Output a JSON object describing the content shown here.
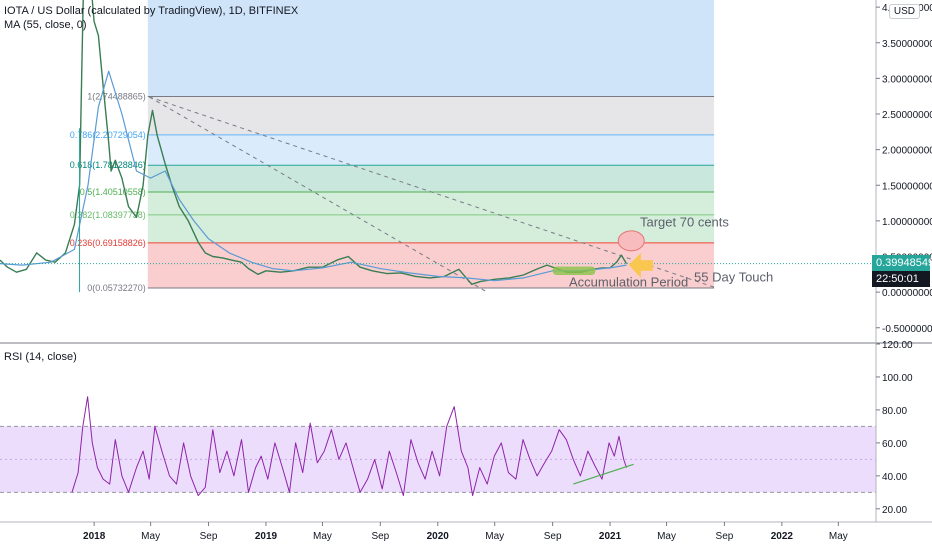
{
  "header": {
    "title": "IOTA / US Dollar (calculated by TradingView), 1D, BITFINEX",
    "indicator_ma": "MA (55, close, 0)",
    "indicator_rsi": "RSI (14, close)",
    "currency_button": "USD"
  },
  "price_tags": {
    "last_price": "0.39948549",
    "countdown": "22:50:01"
  },
  "colors": {
    "price_tag": "#26a69a",
    "countdown_tag": "#131722",
    "ma_line": "#5b9bd5",
    "rsi_line": "#8e24aa",
    "rsi_band": "#e9d5fb",
    "fib_red": "#f9c6c6",
    "fib_green": "#cdebd5",
    "fib_teal": "#bfe3d6",
    "fib_blue": "#d4e7fa",
    "fib_gray": "#e2e2e5",
    "blue_box": "#d0e4f9"
  },
  "annotations": {
    "target": "Target 70 cents",
    "touch": "55 Day Touch",
    "accumulation": "Accumulation Period"
  },
  "chart_data": [
    {
      "type": "line",
      "panel": "price",
      "ylim": [
        -0.7,
        4.1
      ],
      "y_ticks": [
        "4.00000000",
        "3.50000000",
        "3.00000000",
        "2.50000000",
        "2.00000000",
        "1.50000000",
        "1.00000000",
        "0.50000000",
        "0.00000000",
        "-0.50000000"
      ],
      "y_tick_values": [
        4.0,
        3.5,
        3.0,
        2.5,
        2.0,
        1.5,
        1.0,
        0.5,
        0.0,
        -0.5
      ],
      "x_ticks": [
        "2018",
        "May",
        "Sep",
        "2019",
        "May",
        "Sep",
        "2020",
        "May",
        "Sep",
        "2021",
        "May",
        "Sep",
        "2022",
        "May"
      ],
      "x_tick_dates": [
        "2018-01-01",
        "2018-05-01",
        "2018-09-01",
        "2019-01-01",
        "2019-05-01",
        "2019-09-01",
        "2020-01-01",
        "2020-05-01",
        "2020-09-01",
        "2021-01-01",
        "2021-05-01",
        "2021-09-01",
        "2022-01-01",
        "2022-05-01"
      ],
      "xlim": [
        "2017-06-15",
        "2022-07-20"
      ],
      "series": [
        {
          "role": "price",
          "dates": [
            "2017-06-15",
            "2017-07-01",
            "2017-07-20",
            "2017-08-10",
            "2017-09-01",
            "2017-09-20",
            "2017-10-10",
            "2017-11-01",
            "2017-11-20",
            "2017-12-01",
            "2017-12-06",
            "2017-12-10",
            "2017-12-19",
            "2018-01-01",
            "2018-01-10",
            "2018-01-20",
            "2018-02-01",
            "2018-02-06",
            "2018-02-15",
            "2018-03-01",
            "2018-03-15",
            "2018-04-01",
            "2018-04-15",
            "2018-04-25",
            "2018-05-05",
            "2018-05-15",
            "2018-06-01",
            "2018-06-15",
            "2018-07-01",
            "2018-07-20",
            "2018-08-10",
            "2018-08-25",
            "2018-09-10",
            "2018-10-01",
            "2018-10-20",
            "2018-11-10",
            "2018-11-25",
            "2018-12-15",
            "2019-01-01",
            "2019-02-01",
            "2019-03-01",
            "2019-04-01",
            "2019-05-01",
            "2019-06-01",
            "2019-06-25",
            "2019-07-20",
            "2019-08-15",
            "2019-09-15",
            "2019-10-15",
            "2019-11-15",
            "2019-12-15",
            "2020-01-15",
            "2020-02-15",
            "2020-03-13",
            "2020-04-01",
            "2020-05-01",
            "2020-06-01",
            "2020-07-01",
            "2020-08-01",
            "2020-08-20",
            "2020-09-10",
            "2020-10-01",
            "2020-11-01",
            "2020-11-25",
            "2020-12-15",
            "2021-01-01",
            "2021-01-15",
            "2021-01-25",
            "2021-02-05"
          ],
          "values": [
            0.45,
            0.35,
            0.28,
            0.32,
            0.55,
            0.45,
            0.42,
            0.55,
            0.95,
            1.5,
            3.2,
            4.5,
            4.8,
            3.8,
            3.6,
            2.9,
            2.1,
            1.7,
            1.85,
            1.6,
            1.2,
            1.05,
            1.5,
            2.2,
            2.55,
            2.2,
            1.8,
            1.5,
            1.2,
            1.0,
            0.7,
            0.55,
            0.5,
            0.48,
            0.45,
            0.42,
            0.33,
            0.25,
            0.3,
            0.28,
            0.3,
            0.35,
            0.35,
            0.45,
            0.5,
            0.35,
            0.3,
            0.26,
            0.27,
            0.22,
            0.2,
            0.22,
            0.32,
            0.11,
            0.15,
            0.18,
            0.2,
            0.24,
            0.33,
            0.38,
            0.33,
            0.28,
            0.28,
            0.32,
            0.34,
            0.34,
            0.42,
            0.52,
            0.4
          ]
        },
        {
          "role": "ma55",
          "dates": [
            "2017-06-15",
            "2017-08-01",
            "2017-10-01",
            "2017-11-20",
            "2017-12-19",
            "2018-01-10",
            "2018-02-01",
            "2018-03-01",
            "2018-04-01",
            "2018-05-01",
            "2018-06-01",
            "2018-07-01",
            "2018-08-01",
            "2018-09-01",
            "2018-10-15",
            "2018-12-01",
            "2019-01-15",
            "2019-03-01",
            "2019-05-01",
            "2019-07-01",
            "2019-09-01",
            "2019-11-01",
            "2020-01-01",
            "2020-03-01",
            "2020-05-01",
            "2020-07-01",
            "2020-09-01",
            "2020-11-01",
            "2021-01-01",
            "2021-02-05"
          ],
          "values": [
            0.4,
            0.38,
            0.42,
            0.6,
            1.5,
            2.6,
            3.1,
            2.5,
            1.7,
            1.6,
            1.7,
            1.3,
            1.0,
            0.75,
            0.55,
            0.42,
            0.33,
            0.3,
            0.34,
            0.42,
            0.33,
            0.27,
            0.22,
            0.2,
            0.16,
            0.2,
            0.3,
            0.3,
            0.34,
            0.38
          ]
        }
      ],
      "fib_retracement": {
        "levels": [
          {
            "label": "1(2.74488865)",
            "value": 2.74488865
          },
          {
            "label": "0.786(2.20729054)",
            "value": 2.20729054
          },
          {
            "label": "0.618(1.78128846)",
            "value": 1.78128846
          },
          {
            "label": "0.5(1.40510558)",
            "value": 1.40510558
          },
          {
            "label": "0.382(1.08397738)",
            "value": 1.08397738
          },
          {
            "label": "0.236(0.69158826)",
            "value": 0.69158826
          },
          {
            "label": "0(0.05732270)",
            "value": 0.0573227
          }
        ]
      }
    },
    {
      "type": "line",
      "panel": "rsi",
      "ylim": [
        12,
        120
      ],
      "y_ticks": [
        "120.00",
        "100.00",
        "80.00",
        "60.00",
        "40.00",
        "20.00"
      ],
      "y_tick_values": [
        120,
        100,
        80,
        60,
        40,
        20
      ],
      "band": [
        30,
        70
      ],
      "series": [
        {
          "role": "rsi",
          "dates": [
            "2017-11-15",
            "2017-11-28",
            "2017-12-08",
            "2017-12-18",
            "2017-12-28",
            "2018-01-08",
            "2018-01-20",
            "2018-02-03",
            "2018-02-15",
            "2018-03-01",
            "2018-03-15",
            "2018-04-01",
            "2018-04-15",
            "2018-04-28",
            "2018-05-10",
            "2018-05-25",
            "2018-06-10",
            "2018-06-25",
            "2018-07-10",
            "2018-07-25",
            "2018-08-10",
            "2018-08-25",
            "2018-09-10",
            "2018-09-25",
            "2018-10-10",
            "2018-10-25",
            "2018-11-10",
            "2018-11-25",
            "2018-12-10",
            "2018-12-22",
            "2019-01-05",
            "2019-01-20",
            "2019-02-05",
            "2019-02-20",
            "2019-03-05",
            "2019-03-20",
            "2019-04-05",
            "2019-04-20",
            "2019-05-05",
            "2019-05-20",
            "2019-06-05",
            "2019-06-20",
            "2019-07-05",
            "2019-07-20",
            "2019-08-05",
            "2019-08-20",
            "2019-09-05",
            "2019-09-20",
            "2019-10-05",
            "2019-10-20",
            "2019-11-05",
            "2019-11-20",
            "2019-12-05",
            "2019-12-20",
            "2020-01-05",
            "2020-01-20",
            "2020-02-05",
            "2020-02-20",
            "2020-03-05",
            "2020-03-15",
            "2020-03-30",
            "2020-04-15",
            "2020-04-30",
            "2020-05-15",
            "2020-05-30",
            "2020-06-15",
            "2020-06-30",
            "2020-07-15",
            "2020-07-30",
            "2020-08-15",
            "2020-08-30",
            "2020-09-15",
            "2020-09-30",
            "2020-10-15",
            "2020-10-30",
            "2020-11-15",
            "2020-11-30",
            "2020-12-15",
            "2020-12-30",
            "2021-01-10",
            "2021-01-20",
            "2021-01-30",
            "2021-02-05"
          ],
          "values": [
            30,
            42,
            70,
            88,
            60,
            45,
            38,
            35,
            62,
            40,
            30,
            45,
            55,
            38,
            70,
            55,
            40,
            35,
            60,
            40,
            28,
            33,
            68,
            42,
            55,
            40,
            62,
            30,
            45,
            52,
            38,
            60,
            45,
            30,
            60,
            42,
            72,
            48,
            55,
            68,
            50,
            60,
            45,
            30,
            38,
            50,
            32,
            55,
            42,
            28,
            62,
            48,
            38,
            55,
            40,
            70,
            82,
            55,
            45,
            28,
            45,
            35,
            52,
            60,
            42,
            38,
            62,
            50,
            40,
            48,
            55,
            68,
            62,
            50,
            40,
            55,
            46,
            38,
            60,
            52,
            64,
            50,
            45
          ]
        },
        {
          "role": "trendline",
          "dates": [
            "2020-10-15",
            "2021-02-20"
          ],
          "values": [
            35,
            47
          ]
        }
      ]
    }
  ]
}
